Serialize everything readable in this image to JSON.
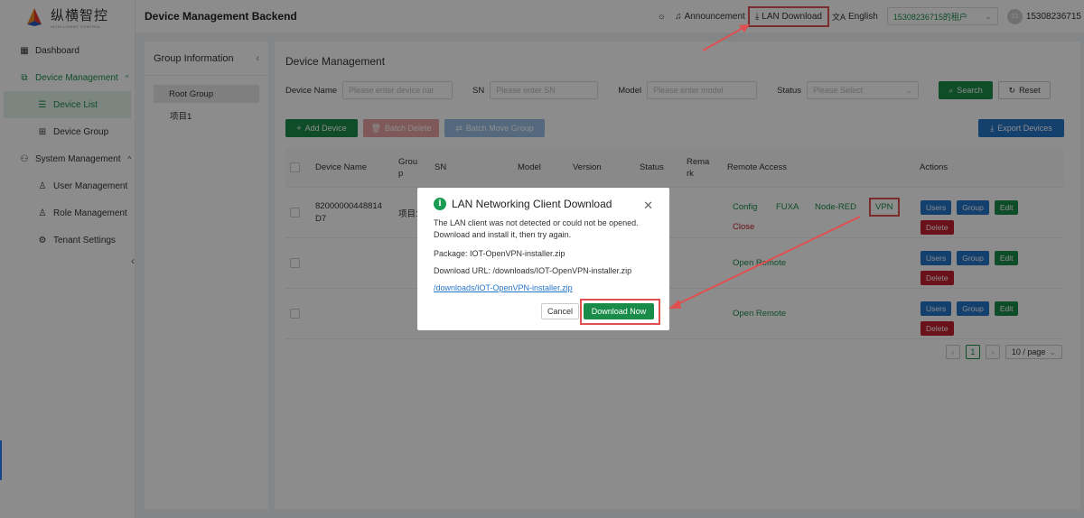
{
  "brand": {
    "name": "纵横智控",
    "sub": "INTELLIGENT CONTROL"
  },
  "header": {
    "title": "Device Management Backend",
    "announcement": "Announcement",
    "lan_download": "LAN Download",
    "language": "English",
    "tenant": "15308236715的租户",
    "avatar": "15",
    "username": "15308236715"
  },
  "sidebar": {
    "items": [
      {
        "label": "Dashboard"
      },
      {
        "label": "Device Management"
      },
      {
        "label": "Device List"
      },
      {
        "label": "Device Group"
      },
      {
        "label": "System Management"
      },
      {
        "label": "User Management"
      },
      {
        "label": "Role Management"
      },
      {
        "label": "Tenant Settings"
      }
    ]
  },
  "groups": {
    "title": "Group Information",
    "items": [
      "Root Group",
      "项目1"
    ]
  },
  "main": {
    "title": "Device Management",
    "filters": {
      "device_name_label": "Device Name",
      "device_name_placeholder": "Please enter device nar",
      "sn_label": "SN",
      "sn_placeholder": "Please enter SN",
      "model_label": "Model",
      "model_placeholder": "Please enter model",
      "status_label": "Status",
      "status_placeholder": "Please Select",
      "search": "Search",
      "reset": "Reset"
    },
    "toolbar": {
      "add": "Add Device",
      "batch_delete": "Batch Delete",
      "batch_move": "Batch Move Group",
      "export": "Export Devices"
    },
    "table": {
      "columns": [
        "Device Name",
        "Grou p",
        "SN",
        "Model",
        "Version",
        "Status",
        "Rema rk",
        "Remote Access",
        "Actions"
      ],
      "rows": [
        {
          "name": "82000000448814 D7",
          "group": "项目1",
          "access": [
            "Config",
            "FUXA",
            "Node-RED",
            "VPN",
            "Close"
          ]
        },
        {
          "name": "",
          "group": "",
          "access": [
            "Open Remote"
          ]
        },
        {
          "name": "",
          "group": "",
          "access": [
            "Open Remote"
          ]
        }
      ],
      "actions": {
        "users": "Users",
        "group": "Group",
        "edit": "Edit",
        "delete": "Delete"
      }
    },
    "pager": {
      "prev": "‹",
      "page": "1",
      "next": "›",
      "size": "10 / page"
    }
  },
  "modal": {
    "title": "LAN Networking Client Download",
    "message": "The LAN client was not detected or could not be opened. Download and install it, then try again.",
    "package": "Package: IOT-OpenVPN-installer.zip",
    "url_text": "Download URL: /downloads/IOT-OpenVPN-installer.zip",
    "link": "/downloads/IOT-OpenVPN-installer.zip",
    "cancel": "Cancel",
    "download": "Download Now"
  },
  "colors": {
    "brand_green": "#1a8c4a",
    "action_blue": "#2676c9",
    "danger_red": "#c2202e",
    "annotation_red": "#e05050"
  }
}
